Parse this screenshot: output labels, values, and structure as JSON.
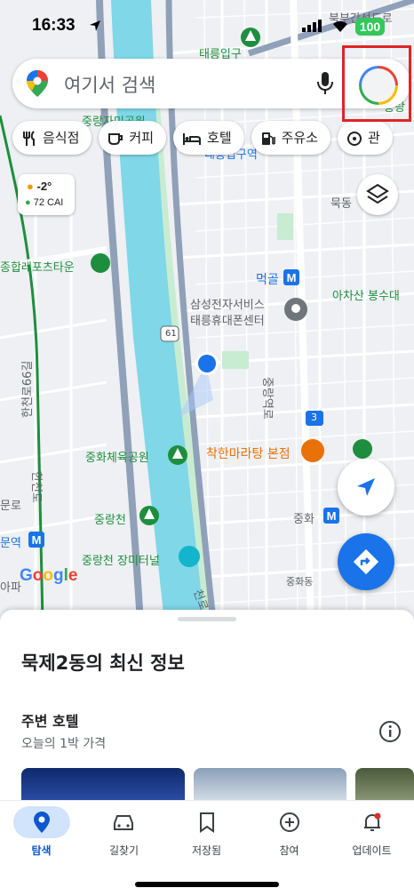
{
  "status": {
    "time": "16:33",
    "battery": "100"
  },
  "search": {
    "placeholder": "여기서 검색"
  },
  "chips": [
    {
      "label": "음식점",
      "icon": "fork-knife-icon"
    },
    {
      "label": "커피",
      "icon": "coffee-icon"
    },
    {
      "label": "호텔",
      "icon": "bed-icon"
    },
    {
      "label": "주유소",
      "icon": "gas-pump-icon"
    },
    {
      "label": "관",
      "icon": "attraction-icon"
    }
  ],
  "weather": {
    "temp": "-2°",
    "aqi": "72 CAI"
  },
  "map_labels": {
    "l1": "북부간선도로",
    "l2": "태릉입구",
    "l3": "중랑",
    "l4": "중랑자미공원",
    "l5": "태릉입구역",
    "l6": "묵동",
    "l7": "종합레포츠타운",
    "l8": "먹골",
    "l9": "아차산 봉수대",
    "l10": "삼성전자서비스",
    "l11": "태릉휴대폰센터",
    "l12": "61",
    "l13": "61",
    "l14": "한천로66길",
    "l15": "중랑역로",
    "l16": "3",
    "l17": "중화체육공원",
    "l18": "착한마라탕 본점",
    "l19": "중랑천",
    "l20": "한천로",
    "l21": "문로",
    "l22": "중화",
    "l23": "문역",
    "l24": "중랑천 장미터널",
    "l25": "아파",
    "l26": "중화동",
    "l27": "천로"
  },
  "sheet": {
    "title": "묵제2동의 최신 정보",
    "section": "주변 호텔",
    "subtitle": "오늘의 1박 가격"
  },
  "nav": [
    {
      "label": "탐색",
      "icon": "explore-pin-icon",
      "active": true
    },
    {
      "label": "길찾기",
      "icon": "car-icon"
    },
    {
      "label": "저장됨",
      "icon": "bookmark-icon"
    },
    {
      "label": "참여",
      "icon": "plus-circle-icon"
    },
    {
      "label": "업데이트",
      "icon": "bell-icon"
    }
  ],
  "colors": {
    "accent": "#1a73e8",
    "battery": "#34c759",
    "highlight": "#e02424",
    "river": "#7fd7e8",
    "park": "#c8ecd1"
  }
}
